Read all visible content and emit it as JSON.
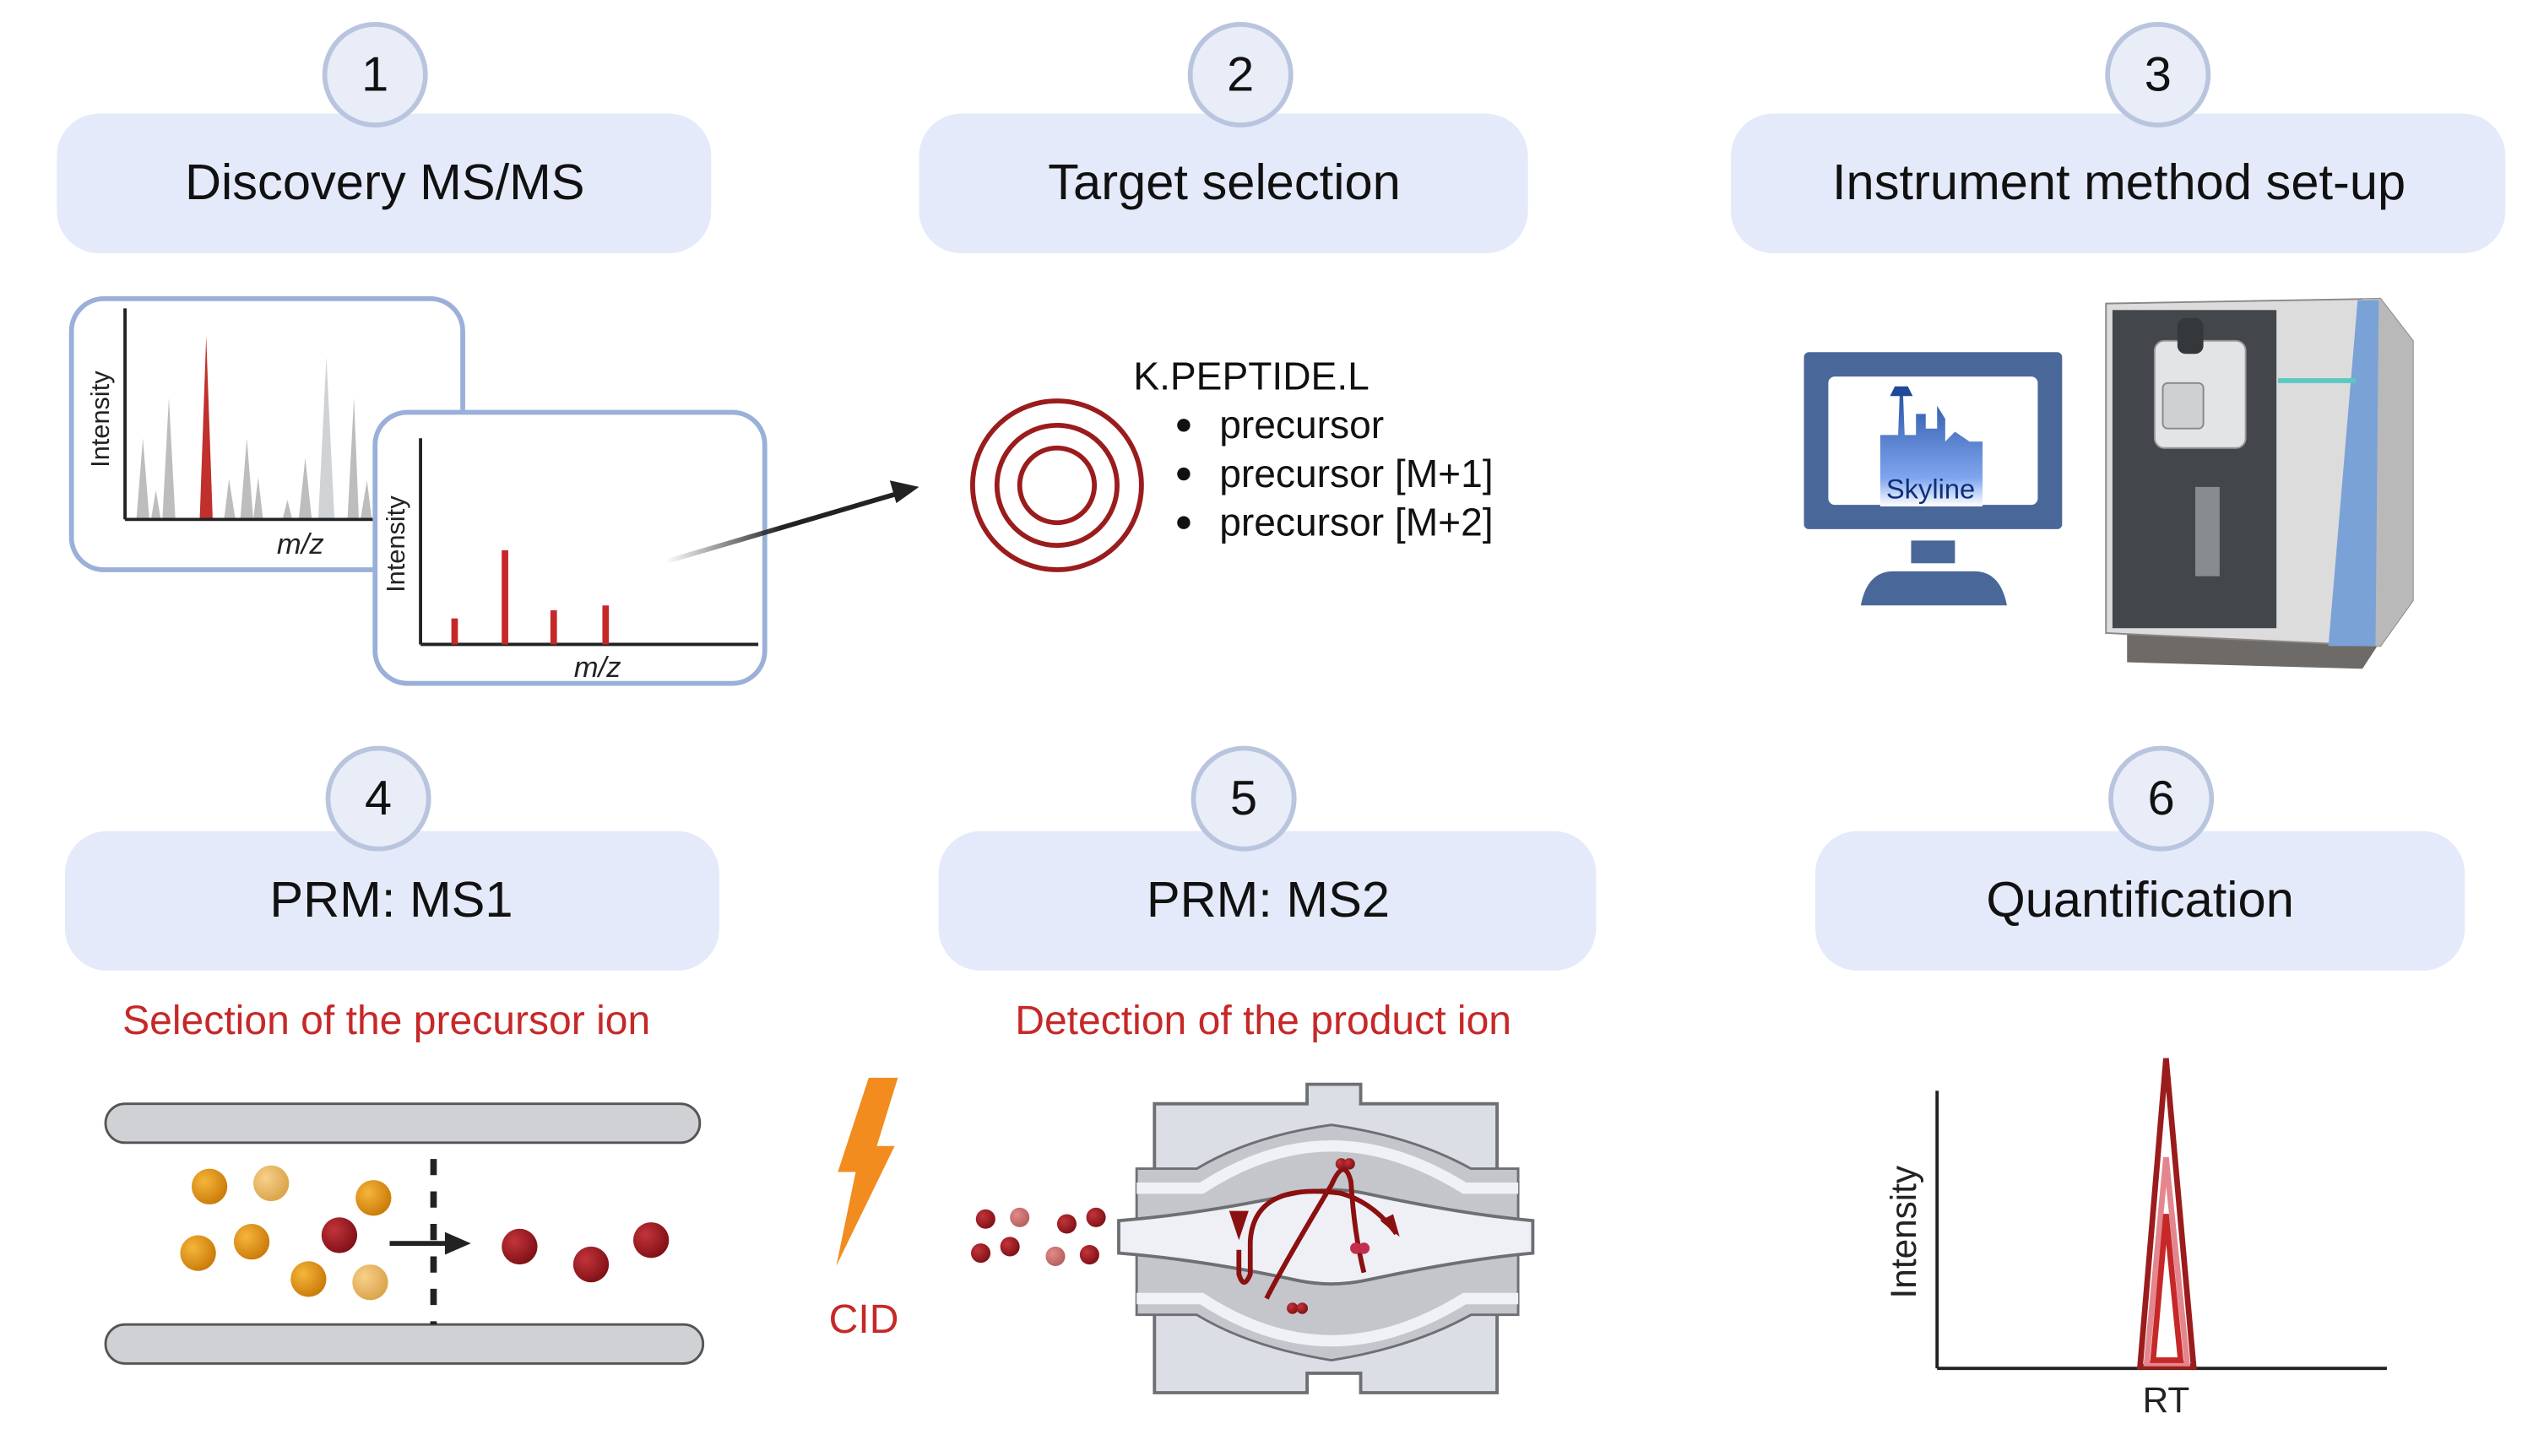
{
  "steps": [
    {
      "number": "1",
      "title": "Discovery MS/MS"
    },
    {
      "number": "2",
      "title": "Target selection"
    },
    {
      "number": "3",
      "title": "Instrument method set-up"
    },
    {
      "number": "4",
      "title": "PRM: MS1",
      "subtitle": "Selection of the precursor ion"
    },
    {
      "number": "5",
      "title": "PRM: MS2",
      "subtitle": "Detection of the product ion"
    },
    {
      "number": "6",
      "title": "Quantification"
    }
  ],
  "discovery": {
    "ylabel": "Intensity",
    "xlabel": "m/z"
  },
  "target": {
    "peptide": "K.PEPTIDE.L",
    "items": [
      "precursor",
      "precursor [M+1]",
      "precursor [M+2]"
    ]
  },
  "instrument": {
    "software_logo": "Skyline"
  },
  "ms2": {
    "fragmentation": "CID"
  },
  "quant": {
    "ylabel": "Intensity",
    "xlabel": "RT"
  },
  "colors": {
    "header_bg": "#e4eaf9",
    "accent_red": "#c62828",
    "dark_red": "#9b1c1c",
    "card_border": "#9ab0d8",
    "lightning": "#f28c1e"
  }
}
